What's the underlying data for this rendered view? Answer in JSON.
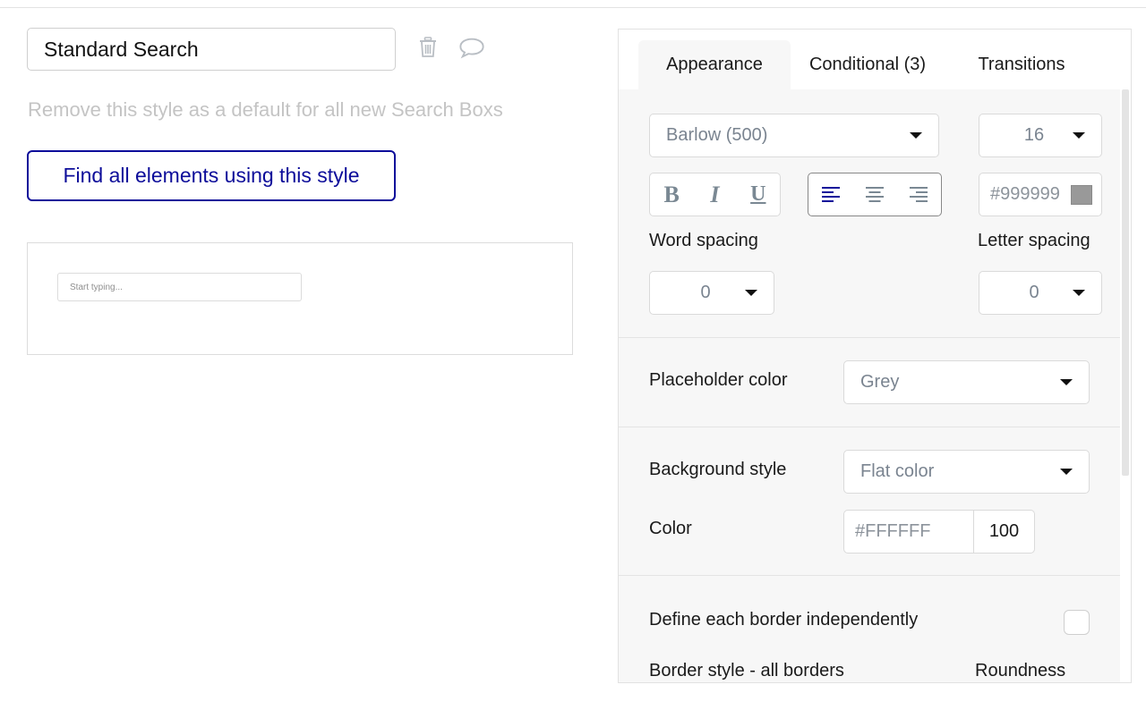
{
  "style": {
    "name": "Standard Search",
    "remove_default_label": "Remove this style as a default for all new Search Boxs",
    "find_button_label": "Find all elements using this style",
    "preview_placeholder": "Start typing..."
  },
  "tabs": [
    {
      "label": "Appearance",
      "active": true
    },
    {
      "label": "Conditional (3)",
      "active": false
    },
    {
      "label": "Transitions",
      "active": false
    }
  ],
  "appearance": {
    "font": "Barlow (500)",
    "font_size": "16",
    "font_color": "#999999",
    "word_spacing_label": "Word spacing",
    "word_spacing": "0",
    "letter_spacing_label": "Letter spacing",
    "letter_spacing": "0",
    "placeholder_color_label": "Placeholder color",
    "placeholder_color": "Grey",
    "background_style_label": "Background style",
    "background_style": "Flat color",
    "color_label": "Color",
    "color_hex": "#FFFFFF",
    "color_opacity": "100",
    "border_independent_label": "Define each border independently",
    "border_style_label": "Border style - all borders",
    "roundness_label": "Roundness"
  },
  "format_buttons": {
    "bold": "B",
    "italic": "I",
    "underline": "U"
  },
  "colors": {
    "accent": "#0d0d9a",
    "swatch": "#999999"
  }
}
